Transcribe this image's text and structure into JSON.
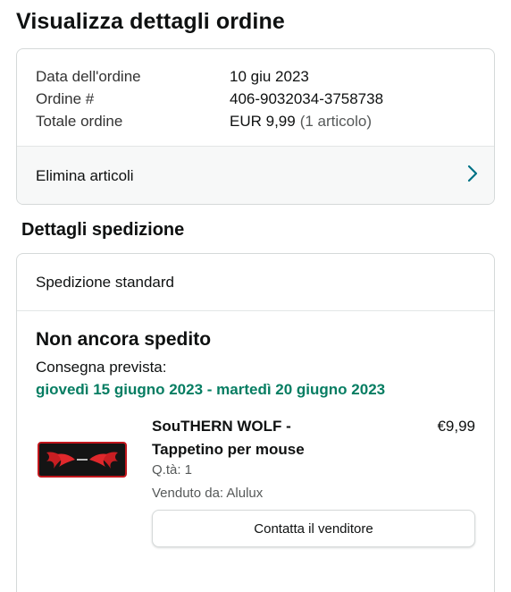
{
  "page": {
    "title": "Visualizza dettagli ordine"
  },
  "order_summary": {
    "rows": [
      {
        "label": "Data dell'ordine",
        "value": "10 giu 2023"
      },
      {
        "label": "Ordine #",
        "value": "406-9032034-3758738"
      },
      {
        "label": "Totale ordine",
        "value": "EUR 9,99",
        "extra": "(1 articolo)"
      }
    ],
    "delete_items_label": "Elimina articoli",
    "chevron_icon": "chevron-right-icon"
  },
  "shipping": {
    "heading": "Dettagli spedizione",
    "method": "Spedizione standard",
    "status": "Non ancora spedito",
    "delivery_label": "Consegna prevista:",
    "delivery_dates": "giovedì 15 giugno 2023 - martedì 20 giugno 2023",
    "status_color": "#067d62"
  },
  "product": {
    "name_line1": "SouTHERN WOLF -",
    "name_line2": "Tappetino per mouse",
    "price": "€9,99",
    "quantity": "Q.tà: 1",
    "seller": "Venduto da: Alulux",
    "contact_button": "Contatta il venditore",
    "image_icon": "mousepad-product-image"
  },
  "colors": {
    "accent_link": "#007185",
    "border": "#d5d9d9"
  }
}
